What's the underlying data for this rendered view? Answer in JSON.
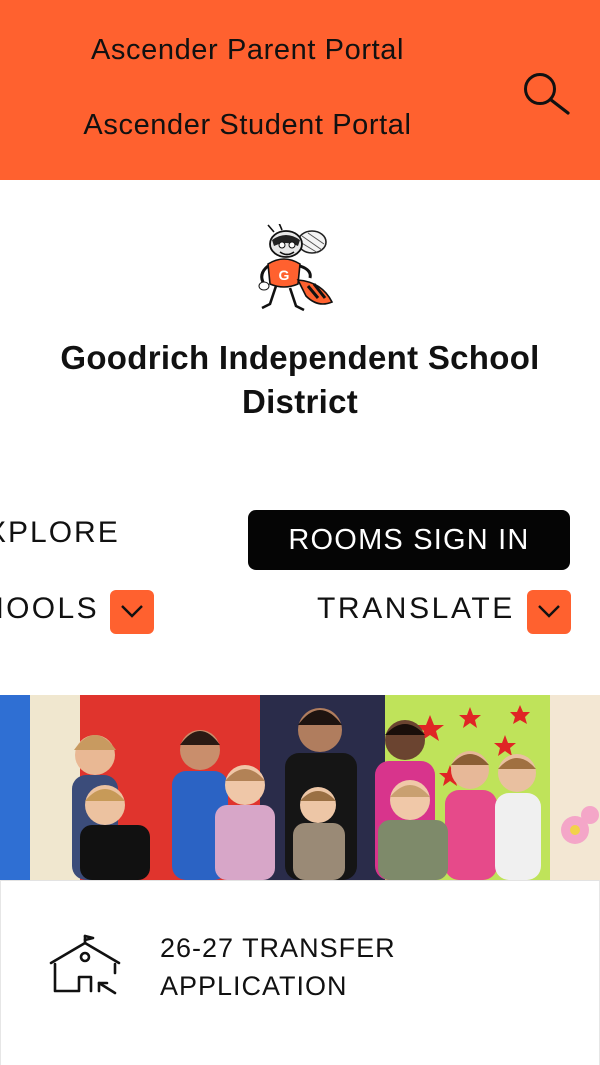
{
  "header": {
    "links": [
      "Ascender Parent Portal",
      "Ascender Student Portal"
    ],
    "search_icon": "search-icon",
    "accent_color": "#ff612f"
  },
  "branding": {
    "district_name": "Goodrich Independent School District",
    "logo": "hornet-mascot-logo"
  },
  "nav": {
    "explore_label": "XPLORE",
    "rooms_label": "ROOMS SIGN IN",
    "schools_label": "HOOLS",
    "translate_label": "TRANSLATE",
    "dropdown_icon": "chevron-down-icon"
  },
  "hero": {
    "image": "group-photo-students"
  },
  "cards": [
    {
      "label_line1": "26-27 TRANSFER",
      "label_line2": "APPLICATION",
      "icon": "school-building-icon"
    }
  ]
}
